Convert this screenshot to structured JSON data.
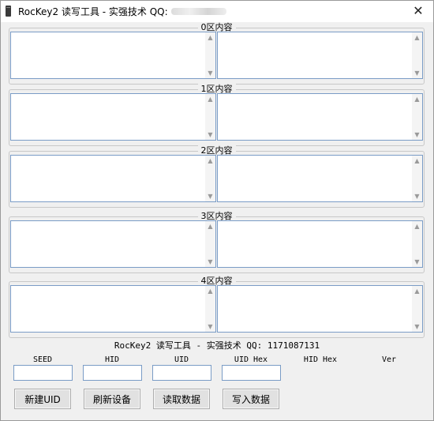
{
  "titlebar": {
    "title": "RocKey2 读写工具 - 实强技术 QQ:",
    "close_glyph": "✕"
  },
  "zones": [
    {
      "label": "0区内容",
      "left_value": "",
      "right_value": ""
    },
    {
      "label": "1区内容",
      "left_value": "",
      "right_value": ""
    },
    {
      "label": "2区内容",
      "left_value": "",
      "right_value": ""
    },
    {
      "label": "3区内容",
      "left_value": "",
      "right_value": ""
    },
    {
      "label": "4区内容",
      "left_value": "",
      "right_value": ""
    }
  ],
  "scroll_glyphs": {
    "up": "▲",
    "down": "▼"
  },
  "status_line": "RocKey2 读写工具 - 实强技术 QQ: 1171087131",
  "fields": {
    "seed": {
      "label": "SEED",
      "value": ""
    },
    "hid": {
      "label": "HID",
      "value": ""
    },
    "uid": {
      "label": "UID",
      "value": ""
    },
    "uid_hex": {
      "label": "UID Hex",
      "value": ""
    },
    "hid_hex": {
      "label": "HID Hex"
    },
    "ver": {
      "label": "Ver"
    }
  },
  "buttons": {
    "new_uid": "新建UID",
    "refresh": "刷新设备",
    "read": "读取数据",
    "write": "写入数据"
  },
  "colors": {
    "window_bg": "#f0f0f0",
    "input_border": "#7a9cc6",
    "button_bg": "#e1e1e1"
  },
  "icons": {
    "app": "app-icon",
    "close": "close-icon",
    "scroll_up": "scroll-up-arrow-icon",
    "scroll_down": "scroll-down-arrow-icon"
  }
}
